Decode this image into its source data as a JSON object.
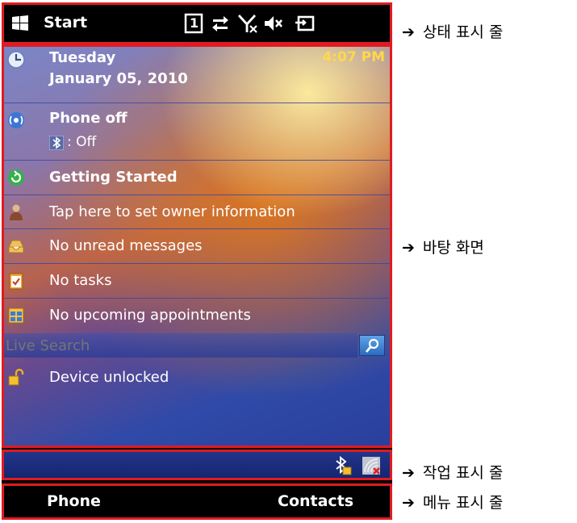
{
  "statusbar": {
    "start_label": "Start",
    "indicator_1": "1"
  },
  "today": {
    "day": "Tuesday",
    "date": "January 05, 2010",
    "time": "4:07 PM",
    "phone_status": "Phone off",
    "bluetooth_status": ": Off",
    "getting_started": "Getting Started",
    "owner_info": "Tap here to set owner information",
    "messages": "No unread messages",
    "tasks": "No tasks",
    "appointments": "No upcoming appointments",
    "search_placeholder": "Live Search",
    "device_lock": "Device unlocked"
  },
  "menubar": {
    "left_softkey": "Phone",
    "right_softkey": "Contacts"
  },
  "annotations": {
    "status_bar": "상태 표시 줄",
    "desktop": "바탕 화면",
    "taskbar": "작업 표시 줄",
    "menubar": "메뉴 표시 줄"
  },
  "colors": {
    "frame": "#e01b22",
    "time": "#ffd84a",
    "taskbar": "#1c2d7e"
  }
}
